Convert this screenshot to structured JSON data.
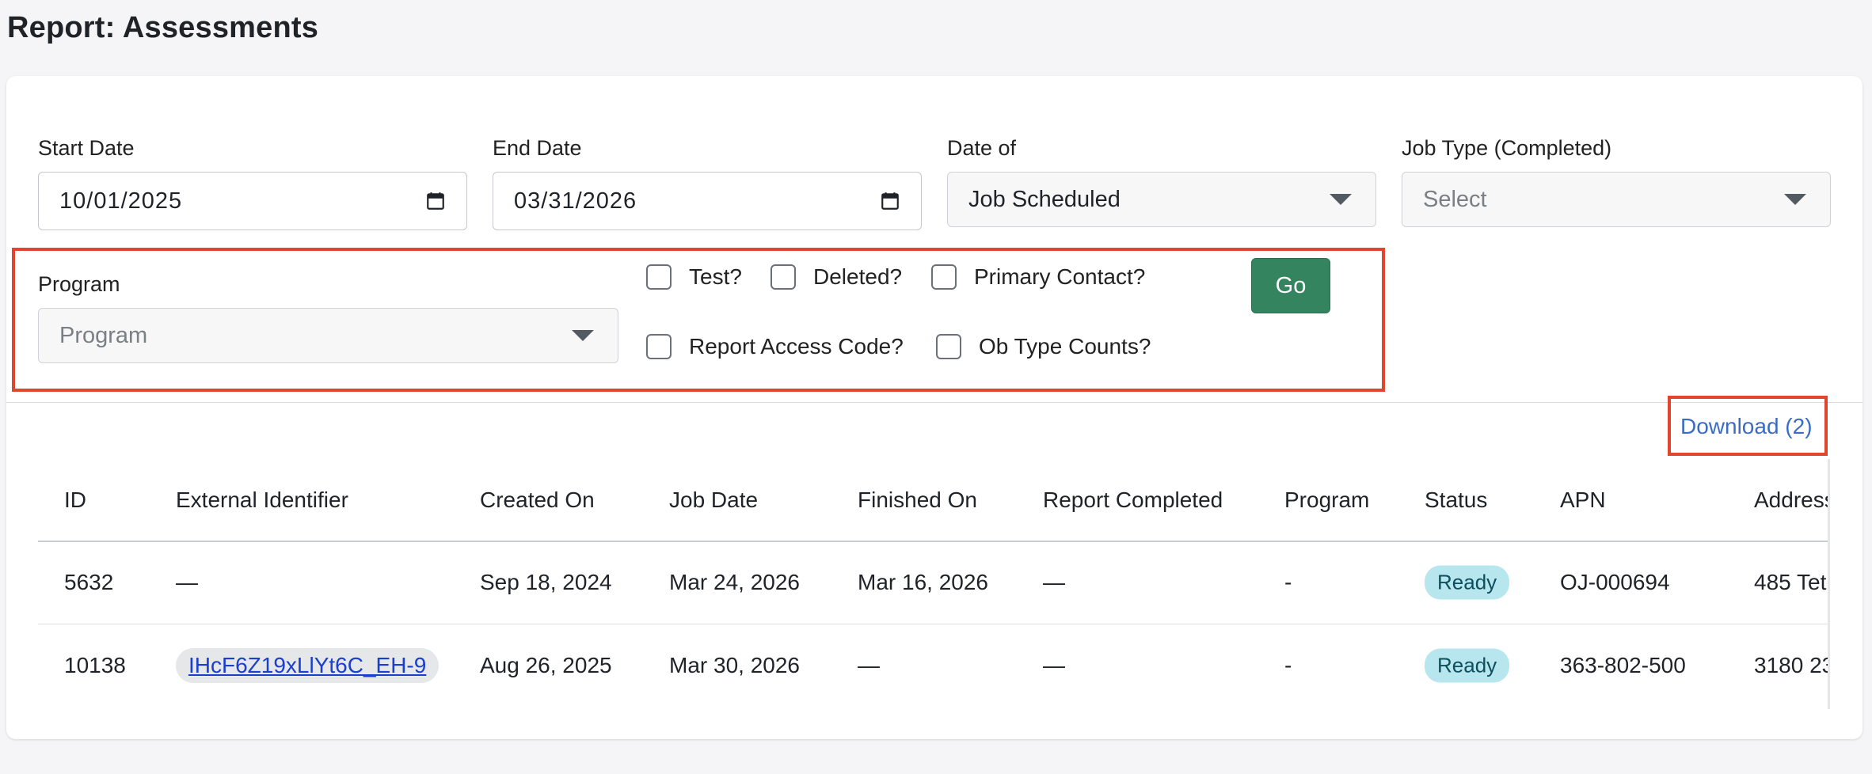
{
  "page": {
    "title": "Report: Assessments"
  },
  "filters": {
    "start_date": {
      "label": "Start Date",
      "value": "10/01/2025"
    },
    "end_date": {
      "label": "End Date",
      "value": "03/31/2026"
    },
    "date_of": {
      "label": "Date of",
      "value": "Job Scheduled"
    },
    "job_type": {
      "label": "Job Type (Completed)",
      "placeholder": "Select"
    },
    "program": {
      "label": "Program",
      "placeholder": "Program"
    },
    "checkboxes": {
      "test": "Test?",
      "deleted": "Deleted?",
      "primary_contact": "Primary Contact?",
      "report_access_code": "Report Access Code?",
      "ob_type_counts": "Ob Type Counts?"
    },
    "go_label": "Go"
  },
  "download": {
    "label": "Download (2)"
  },
  "table": {
    "columns": [
      "ID",
      "External Identifier",
      "Created On",
      "Job Date",
      "Finished On",
      "Report Completed",
      "Program",
      "Status",
      "APN",
      "Address"
    ],
    "rows": [
      [
        "5632",
        "—",
        "Sep 18, 2024",
        "Mar 24, 2026",
        "Mar 16, 2026",
        "—",
        "-",
        "Ready",
        "OJ-000694",
        "485 Tet"
      ],
      [
        "10138",
        "IHcF6Z19xLlYt6C_EH-9",
        "Aug 26, 2025",
        "Mar 30, 2026",
        "—",
        "—",
        "-",
        "Ready",
        "363-802-500",
        "3180 23"
      ]
    ]
  },
  "colors": {
    "highlight": "#e0452d",
    "go_button": "#358460",
    "link": "#3b6cc4",
    "status_badge": "#b7e6ef"
  }
}
